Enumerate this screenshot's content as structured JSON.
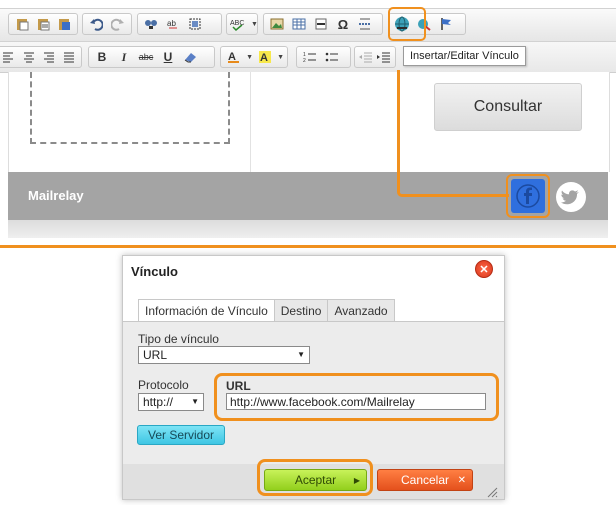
{
  "toolbar": {
    "tooltip": "Insertar/Editar Vínculo",
    "bold_label": "B",
    "italic_label": "I",
    "underline_label": "U",
    "strike_label": "abc",
    "omega_label": "Ω"
  },
  "editor": {
    "button_label": "Consultar",
    "footer_brand": "Mailrelay"
  },
  "dialog": {
    "title": "Vínculo",
    "tabs": [
      {
        "label": "Información de Vínculo"
      },
      {
        "label": "Destino"
      },
      {
        "label": "Avanzado"
      }
    ],
    "link_type_label": "Tipo de vínculo",
    "link_type_value": "URL",
    "protocol_label": "Protocolo",
    "protocol_value": "http://",
    "url_label": "URL",
    "url_value": "http://www.facebook.com/Mailrelay",
    "browse_button": "Ver Servidor",
    "ok_button": "Aceptar",
    "cancel_button": "Cancelar"
  },
  "colors": {
    "highlight": "#f0901e",
    "facebook": "#2f6fde",
    "ok": "#92cf1c",
    "cancel": "#e4501c",
    "browse": "#3ec6e4"
  },
  "icons": [
    "paste-icon",
    "paste-text-icon",
    "paste-word-icon",
    "undo-icon",
    "redo-icon",
    "find-icon",
    "replace-icon",
    "select-all-icon",
    "spellcheck-icon",
    "image-icon",
    "table-icon",
    "horizontal-rule-icon",
    "omega-icon",
    "page-break-icon",
    "link-icon",
    "unlink-icon",
    "anchor-icon",
    "facebook-icon",
    "twitter-icon",
    "close-icon"
  ]
}
